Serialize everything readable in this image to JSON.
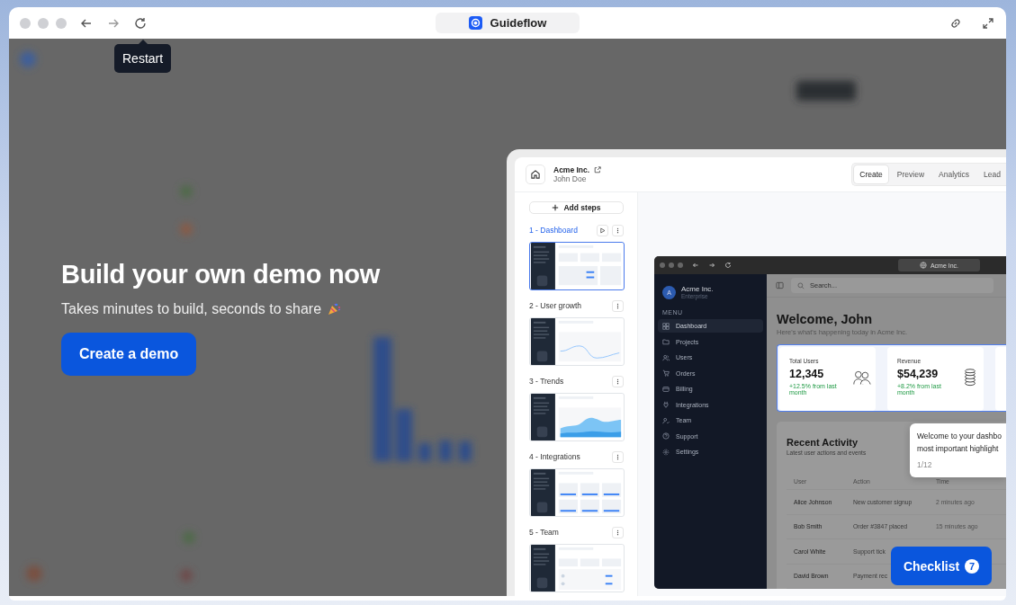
{
  "browser": {
    "title": "Guideflow",
    "tooltip": "Restart"
  },
  "hero": {
    "heading": "Build your own demo now",
    "subtitle": "Takes minutes to build, seconds to share",
    "button": "Create a demo"
  },
  "editor": {
    "company": "Acme Inc.",
    "user": "John Doe",
    "tabs": [
      {
        "label": "Create",
        "selected": true
      },
      {
        "label": "Preview",
        "selected": false
      },
      {
        "label": "Analytics",
        "selected": false
      },
      {
        "label": "Lead",
        "selected": false
      }
    ],
    "add_steps": "Add steps",
    "steps": [
      {
        "label": "1 - Dashboard",
        "selected": true,
        "kind": "dashboard"
      },
      {
        "label": "2 - User growth",
        "selected": false,
        "kind": "line"
      },
      {
        "label": "3 - Trends",
        "selected": false,
        "kind": "area"
      },
      {
        "label": "4 - Integrations",
        "selected": false,
        "kind": "grid"
      },
      {
        "label": "5 - Team",
        "selected": false,
        "kind": "team"
      }
    ]
  },
  "demo": {
    "url": "Acme Inc.",
    "avatar": "A",
    "org": "Acme Inc.",
    "org_sub": "Enterprise",
    "menu_label": "MENU",
    "menu": [
      {
        "label": "Dashboard",
        "selected": true
      },
      {
        "label": "Projects",
        "selected": false
      },
      {
        "label": "Users",
        "selected": false
      },
      {
        "label": "Orders",
        "selected": false
      },
      {
        "label": "Billing",
        "selected": false
      },
      {
        "label": "Integrations",
        "selected": false
      },
      {
        "label": "Team",
        "selected": false
      },
      {
        "label": "Support",
        "selected": false
      },
      {
        "label": "Settings",
        "selected": false
      }
    ],
    "search_placeholder": "Search...",
    "welcome": "Welcome, John",
    "welcome_sub": "Here's what's happening today in Acme Inc.",
    "stats": [
      {
        "label": "Total Users",
        "value": "12,345",
        "change": "+12.5% from last month",
        "kind": "people"
      },
      {
        "label": "Revenue",
        "value": "$54,239",
        "change": "+8.2% from last month",
        "kind": "coins"
      }
    ],
    "activity": {
      "title": "Recent Activity",
      "subtitle": "Latest user actions and events",
      "columns": [
        "User",
        "Action",
        "Time"
      ],
      "rows": [
        [
          "Alice Johnson",
          "New customer signup",
          "2 minutes ago"
        ],
        [
          "Bob Smith",
          "Order #3847 placed",
          "15 minutes ago"
        ],
        [
          "Carol White",
          "Support tick"
        ],
        [
          "David Brown",
          "Payment rec"
        ]
      ]
    }
  },
  "guide": {
    "lines": [
      "Welcome to your dashbo",
      "most important highlight"
    ],
    "progress": "1/12"
  },
  "checklist": {
    "label": "Checklist",
    "count": "7"
  }
}
